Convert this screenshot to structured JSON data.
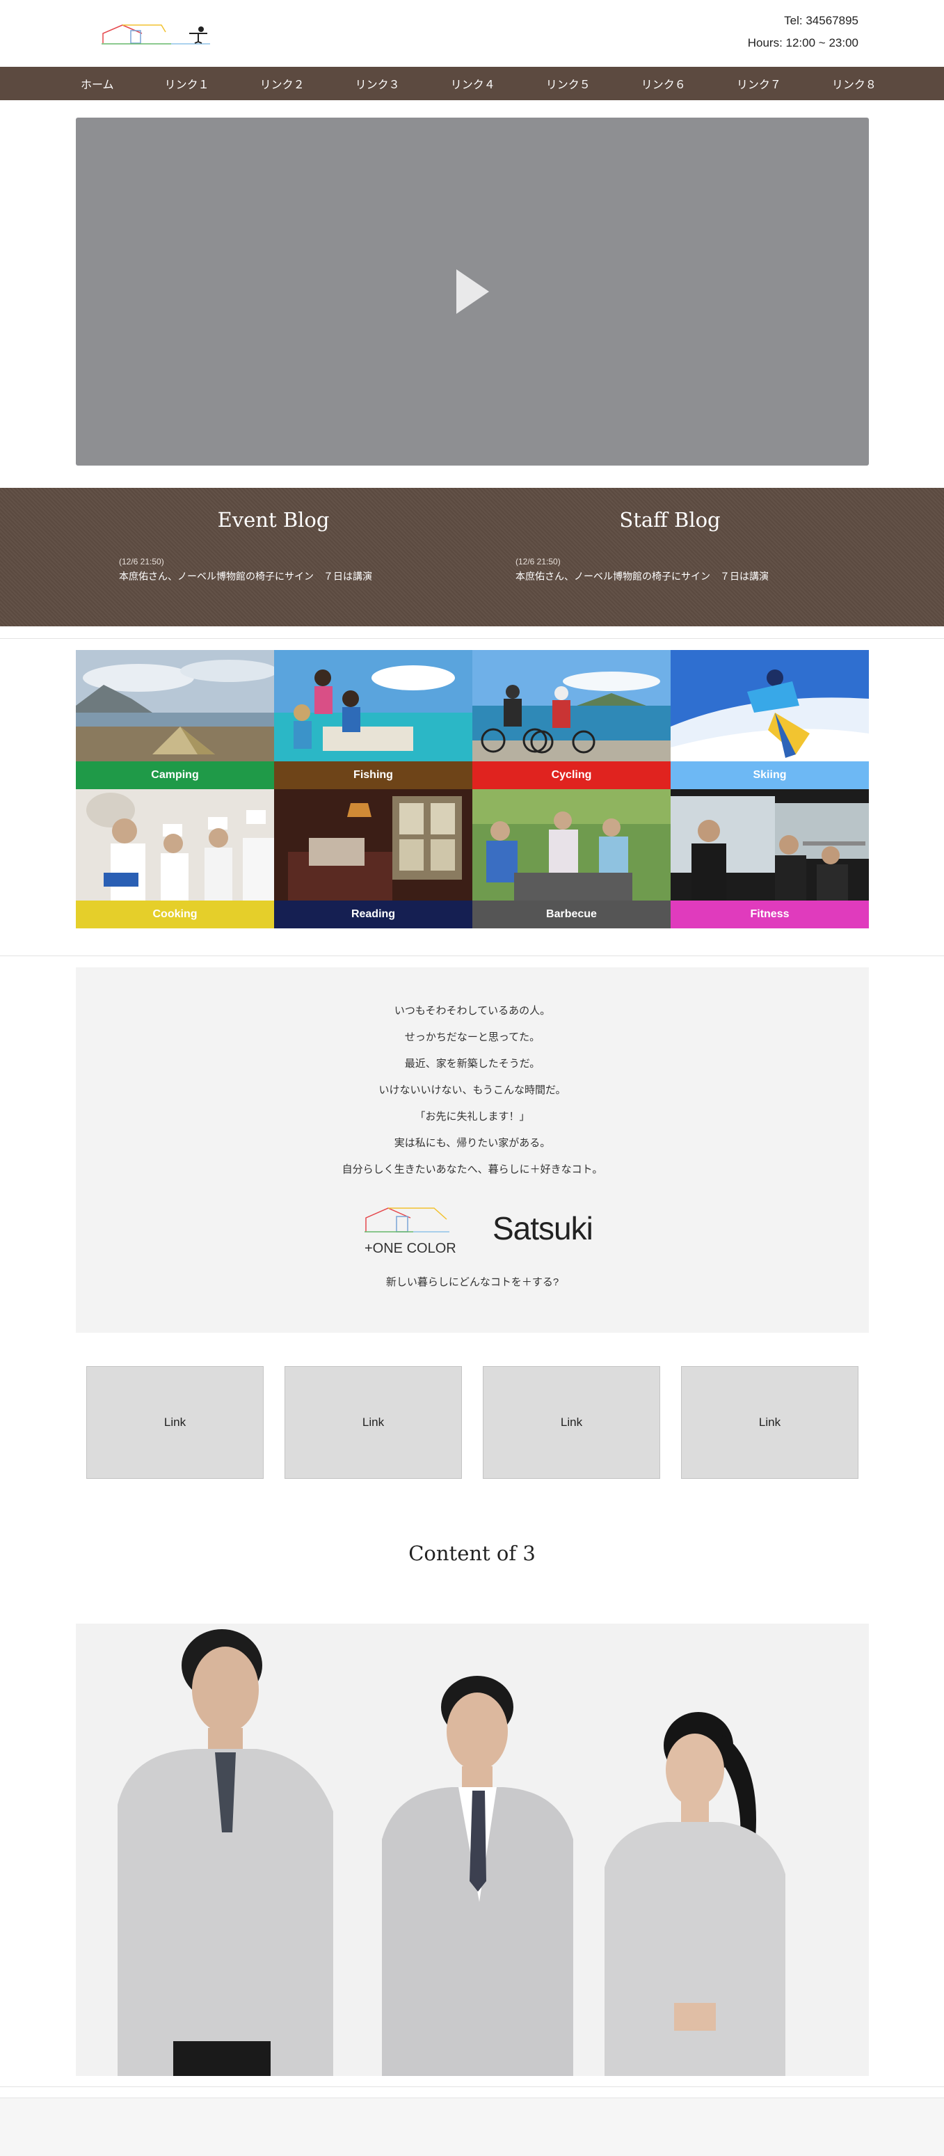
{
  "header": {
    "tel": "Tel: 34567895",
    "hours": "Hours: 12:00 ~ 23:00"
  },
  "nav": {
    "items": [
      "ホーム",
      "リンク１",
      "リンク２",
      "リンク３",
      "リンク４",
      "リンク５",
      "リンク６",
      "リンク７",
      "リンク８"
    ]
  },
  "video": {
    "icon": "play-icon"
  },
  "blogs": [
    {
      "title": "Event Blog",
      "date": "(12/6 21:50)",
      "text": "本庶佑さん、ノーベル博物館の椅子にサイン　７日は講演"
    },
    {
      "title": "Staff Blog",
      "date": "(12/6 21:50)",
      "text": "本庶佑さん、ノーベル博物館の椅子にサイン　７日は講演"
    }
  ],
  "activities": [
    {
      "label": "Camping",
      "color": "#1f9a48"
    },
    {
      "label": "Fishing",
      "color": "#6e4418"
    },
    {
      "label": "Cycling",
      "color": "#e0231f"
    },
    {
      "label": "Skiing",
      "color": "#6db8f4"
    },
    {
      "label": "Cooking",
      "color": "#e5cf2a"
    },
    {
      "label": "Reading",
      "color": "#151f52"
    },
    {
      "label": "Barbecue",
      "color": "#555555"
    },
    {
      "label": "Fitness",
      "color": "#e03bbd"
    }
  ],
  "concept": {
    "lines": [
      "いつもそわそわしているあの人。",
      "せっかちだなーと思ってた。",
      "最近、家を新築したそうだ。",
      "いけないいけない、もうこんな時間だ。",
      "「お先に失礼します！」",
      "実は私にも、帰りたい家がある。",
      "自分らしく生きたいあなたへ、暮らしに＋好きなコト。"
    ],
    "brand_left": "+ONE COLOR",
    "brand_right": "Satsuki",
    "tagline": "新しい暮らしにどんなコトを＋する?"
  },
  "links": [
    "Link",
    "Link",
    "Link",
    "Link"
  ],
  "content_title": "Content of 3"
}
